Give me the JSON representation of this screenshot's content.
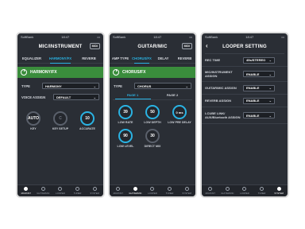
{
  "screen1": {
    "status": {
      "carrier": "SoftBank",
      "time": "18:47"
    },
    "title": "MIC/INSTRUMENT",
    "midi": "MIDI",
    "tabs": [
      "EQUALIZER",
      "HARMONY/FX",
      "REVERB"
    ],
    "active_tab": 1,
    "fx_name": "HARMONY/FX",
    "type_label": "TYPE",
    "type_value": "HARMONY",
    "voice_label": "VOICE ASSIGN",
    "voice_value": "DEFAULT",
    "knobs": [
      {
        "value": "AUTO",
        "label": "KEY",
        "active": false
      },
      {
        "value": "C",
        "label": "KEY SETUP",
        "active": false
      },
      {
        "value": "10",
        "label": "ACCURATE",
        "active": true
      }
    ],
    "nav": [
      "MIC/INST",
      "GUITAR/MIC",
      "LOOPER",
      "TUNER",
      "SYSTEM"
    ],
    "nav_active": 0
  },
  "screen2": {
    "status": {
      "carrier": "SoftBank",
      "time": "18:47"
    },
    "title": "GUITAR/MIC",
    "midi": "MIDI",
    "tabs": [
      "AMP TYPE",
      "CHORUS/FX",
      "DELAY",
      "REVERB"
    ],
    "active_tab": 1,
    "fx_name": "CHORUS/FX",
    "type_label": "TYPE",
    "type_value": "CHORUS",
    "pages": [
      "PAGE 1",
      "PAGE 2"
    ],
    "knobs": [
      {
        "value": "39",
        "label": "LOW RATE",
        "active": true
      },
      {
        "value": "50",
        "label": "LOW DEPTH",
        "active": true
      },
      {
        "value": "0 ms",
        "label": "LOW PRE DELAY",
        "active": true
      },
      {
        "value": "90",
        "label": "LOW LEVEL",
        "active": true
      },
      {
        "value": "30",
        "label": "DIRECT MIX",
        "active": true
      }
    ],
    "nav": [
      "MIC/INST",
      "GUITAR/MIC",
      "LOOPER",
      "TUNER",
      "SYSTEM"
    ],
    "nav_active": 1
  },
  "screen3": {
    "status": {
      "carrier": "SoftBank",
      "time": "18:47"
    },
    "title": "LOOPER SETTING",
    "rows": [
      {
        "label": "REC TIME",
        "value": "45s/STEREO"
      },
      {
        "label": "MIC/INSTRUMENT ASSIGN",
        "value": "ENABLE"
      },
      {
        "label": "GUITAR/MIC ASSIGN",
        "value": "ENABLE"
      },
      {
        "label": "REVERB ASSIGN",
        "value": "ENABLE"
      },
      {
        "label": "I-CUBE LINK/ AUX/Bluetooth ASSIGN",
        "value": "ENABLE"
      }
    ],
    "nav": [
      "MIC/INST",
      "GUITAR/MIC",
      "LOOPER",
      "TUNER",
      "SYSTEM"
    ],
    "nav_active": 4
  }
}
